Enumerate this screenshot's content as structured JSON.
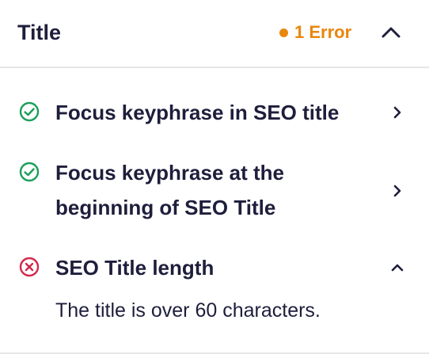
{
  "header": {
    "title": "Title",
    "error_label": "1 Error",
    "toggle_icon": "chevron-up-icon"
  },
  "items": [
    {
      "status": "pass",
      "icon": "check-circle-icon",
      "label": "Focus keyphrase in SEO title",
      "expanded": false,
      "chevron_icon": "chevron-right-icon"
    },
    {
      "status": "pass",
      "icon": "check-circle-icon",
      "label": "Focus keyphrase at the beginning of SEO Title",
      "expanded": false,
      "chevron_icon": "chevron-right-icon"
    },
    {
      "status": "error",
      "icon": "x-circle-icon",
      "label": "SEO Title length",
      "expanded": true,
      "chevron_icon": "chevron-up-icon",
      "description": "The title is over 60 characters."
    }
  ],
  "colors": {
    "text": "#1e1e3c",
    "warning": "#e8860d",
    "pass": "#1c9e5b",
    "error": "#d2284b",
    "divider": "#e6e6e6"
  }
}
